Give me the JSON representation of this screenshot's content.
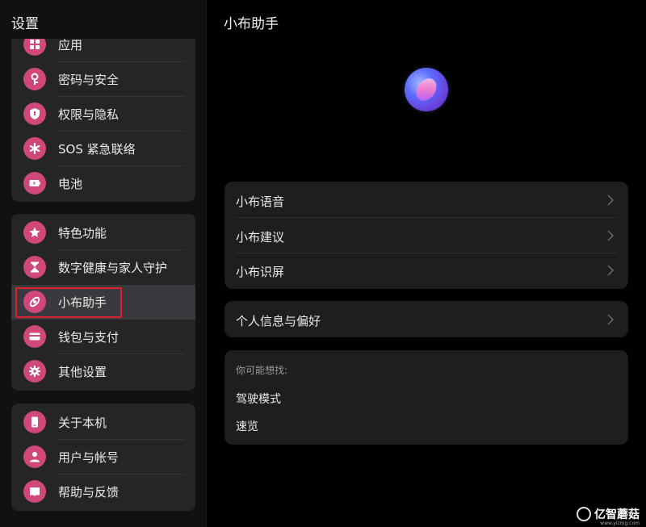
{
  "settings": {
    "title": "设置",
    "group_partial": [
      {
        "label": "应用",
        "icon": "apps-icon"
      },
      {
        "label": "密码与安全",
        "icon": "key-icon"
      },
      {
        "label": "权限与隐私",
        "icon": "shield-icon"
      },
      {
        "label": "SOS 紧急联络",
        "icon": "asterisk-icon"
      },
      {
        "label": "电池",
        "icon": "battery-icon"
      }
    ],
    "group_a": [
      {
        "label": "特色功能",
        "icon": "star-icon"
      },
      {
        "label": "数字健康与家人守护",
        "icon": "hourglass-icon"
      },
      {
        "label": "小布助手",
        "icon": "assistant-icon",
        "selected": true
      },
      {
        "label": "钱包与支付",
        "icon": "wallet-icon"
      },
      {
        "label": "其他设置",
        "icon": "gear-icon"
      }
    ],
    "group_b": [
      {
        "label": "关于本机",
        "icon": "phone-icon"
      },
      {
        "label": "用户与帐号",
        "icon": "user-icon"
      },
      {
        "label": "帮助与反馈",
        "icon": "help-book-icon"
      }
    ]
  },
  "detail": {
    "title": "小布助手",
    "card_a": [
      {
        "label": "小布语音"
      },
      {
        "label": "小布建议"
      },
      {
        "label": "小布识屏"
      }
    ],
    "card_b": [
      {
        "label": "个人信息与偏好"
      }
    ],
    "suggestions": {
      "title": "你可能想找:",
      "items": [
        "驾驶模式",
        "速览"
      ]
    }
  },
  "watermark": {
    "text": "亿智蘑菇",
    "sub": "www.yizmg.com"
  },
  "colors": {
    "accent": "#d0477a",
    "selection": "#e0202a"
  }
}
